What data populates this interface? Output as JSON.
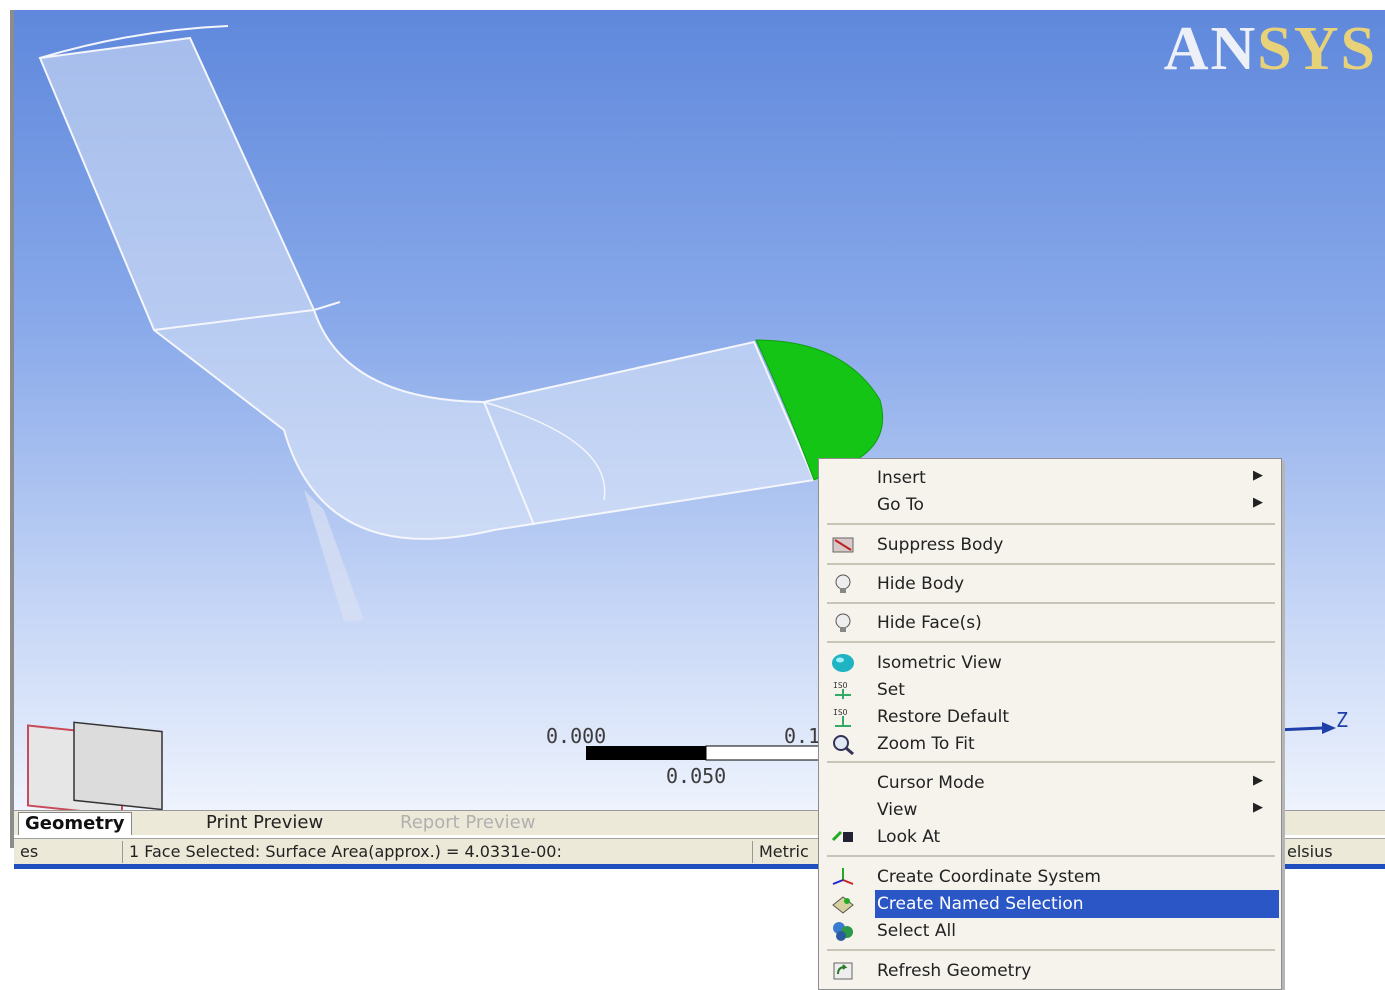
{
  "logo": {
    "an": "AN",
    "sys": "SYS"
  },
  "scale": {
    "left": "0.000",
    "mid": "0.050",
    "right": "0.1"
  },
  "axis": {
    "z": "Z"
  },
  "tabs": [
    {
      "label": "Geometry"
    },
    {
      "label": "Print Preview"
    },
    {
      "label": "Report Preview"
    }
  ],
  "status": {
    "left": "es",
    "selection": "1 Face Selected: Surface Area(approx.) = 4.0331e-00:",
    "units": "Metric",
    "temp": "elsius"
  },
  "menu": {
    "items": [
      {
        "label": "Insert",
        "icon": "none",
        "submenu": true
      },
      {
        "label": "Go To",
        "icon": "none",
        "submenu": true
      },
      {
        "label": "Suppress Body",
        "icon": "suppress-body-icon"
      },
      {
        "label": "Hide Body",
        "icon": "lightbulb-icon"
      },
      {
        "label": "Hide Face(s)",
        "icon": "lightbulb-icon"
      },
      {
        "label": "Isometric View",
        "icon": "sphere-icon"
      },
      {
        "label": "Set",
        "icon": "iso-set-icon"
      },
      {
        "label": "Restore Default",
        "icon": "iso-restore-icon"
      },
      {
        "label": "Zoom To Fit",
        "icon": "zoom-fit-icon"
      },
      {
        "label": "Cursor Mode",
        "icon": "none",
        "submenu": true
      },
      {
        "label": "View",
        "icon": "none",
        "submenu": true
      },
      {
        "label": "Look At",
        "icon": "look-at-icon"
      },
      {
        "label": "Create Coordinate System",
        "icon": "coordinate-system-icon"
      },
      {
        "label": "Create Named Selection",
        "icon": "named-selection-icon",
        "highlighted": true
      },
      {
        "label": "Select All",
        "icon": "select-all-icon"
      },
      {
        "label": "Refresh Geometry",
        "icon": "refresh-icon"
      }
    ]
  },
  "colors": {
    "selected_face": "#15c515",
    "menu_highlight": "#2a56c6",
    "viewport_top": "#5f88dc"
  }
}
